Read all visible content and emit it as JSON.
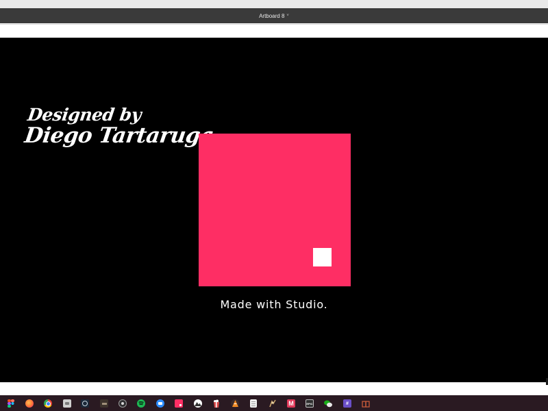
{
  "window": {
    "title": "Artboard 8",
    "title_chevron": "˅"
  },
  "artboard": {
    "signature_line1": "Designed by",
    "signature_line2": "Diego Tartaruga",
    "caption": "Made with Studio.",
    "colors": {
      "background": "#000000",
      "square": "#fe2e64",
      "inner_square": "#ffffff"
    }
  },
  "taskbar": {
    "icons": [
      {
        "name": "figma-icon",
        "color": "#f24e1e"
      },
      {
        "name": "firefox-icon",
        "color": "#ff7139"
      },
      {
        "name": "chrome-icon",
        "color": "#34a853"
      },
      {
        "name": "finder-icon",
        "color": "#c9c9c9"
      },
      {
        "name": "steam-icon",
        "color": "#5a8bb0"
      },
      {
        "name": "unknown-app-icon",
        "color": "#6b5b4e"
      },
      {
        "name": "obs-icon",
        "color": "#4a4a4a"
      },
      {
        "name": "spotify-icon",
        "color": "#1db954"
      },
      {
        "name": "zoom-icon",
        "color": "#2d8cff"
      },
      {
        "name": "studio-icon",
        "color": "#fe2e64"
      },
      {
        "name": "photos-icon",
        "color": "#e6e6e6"
      },
      {
        "name": "popcorn-icon",
        "color": "#d94a4a"
      },
      {
        "name": "vlc-icon",
        "color": "#f08a24"
      },
      {
        "name": "notes-icon",
        "color": "#f2f2f2"
      },
      {
        "name": "game-icon",
        "color": "#b58a4a"
      },
      {
        "name": "mega-icon",
        "color": "#e03a5a"
      },
      {
        "name": "epic-games-icon",
        "color": "#e0e0e0"
      },
      {
        "name": "wechat-icon",
        "color": "#1aad19"
      },
      {
        "name": "slack-icon",
        "color": "#6a4fc8"
      },
      {
        "name": "gift-icon",
        "color": "#c85a3a"
      }
    ],
    "labels": {
      "epic": "EPIC"
    }
  }
}
